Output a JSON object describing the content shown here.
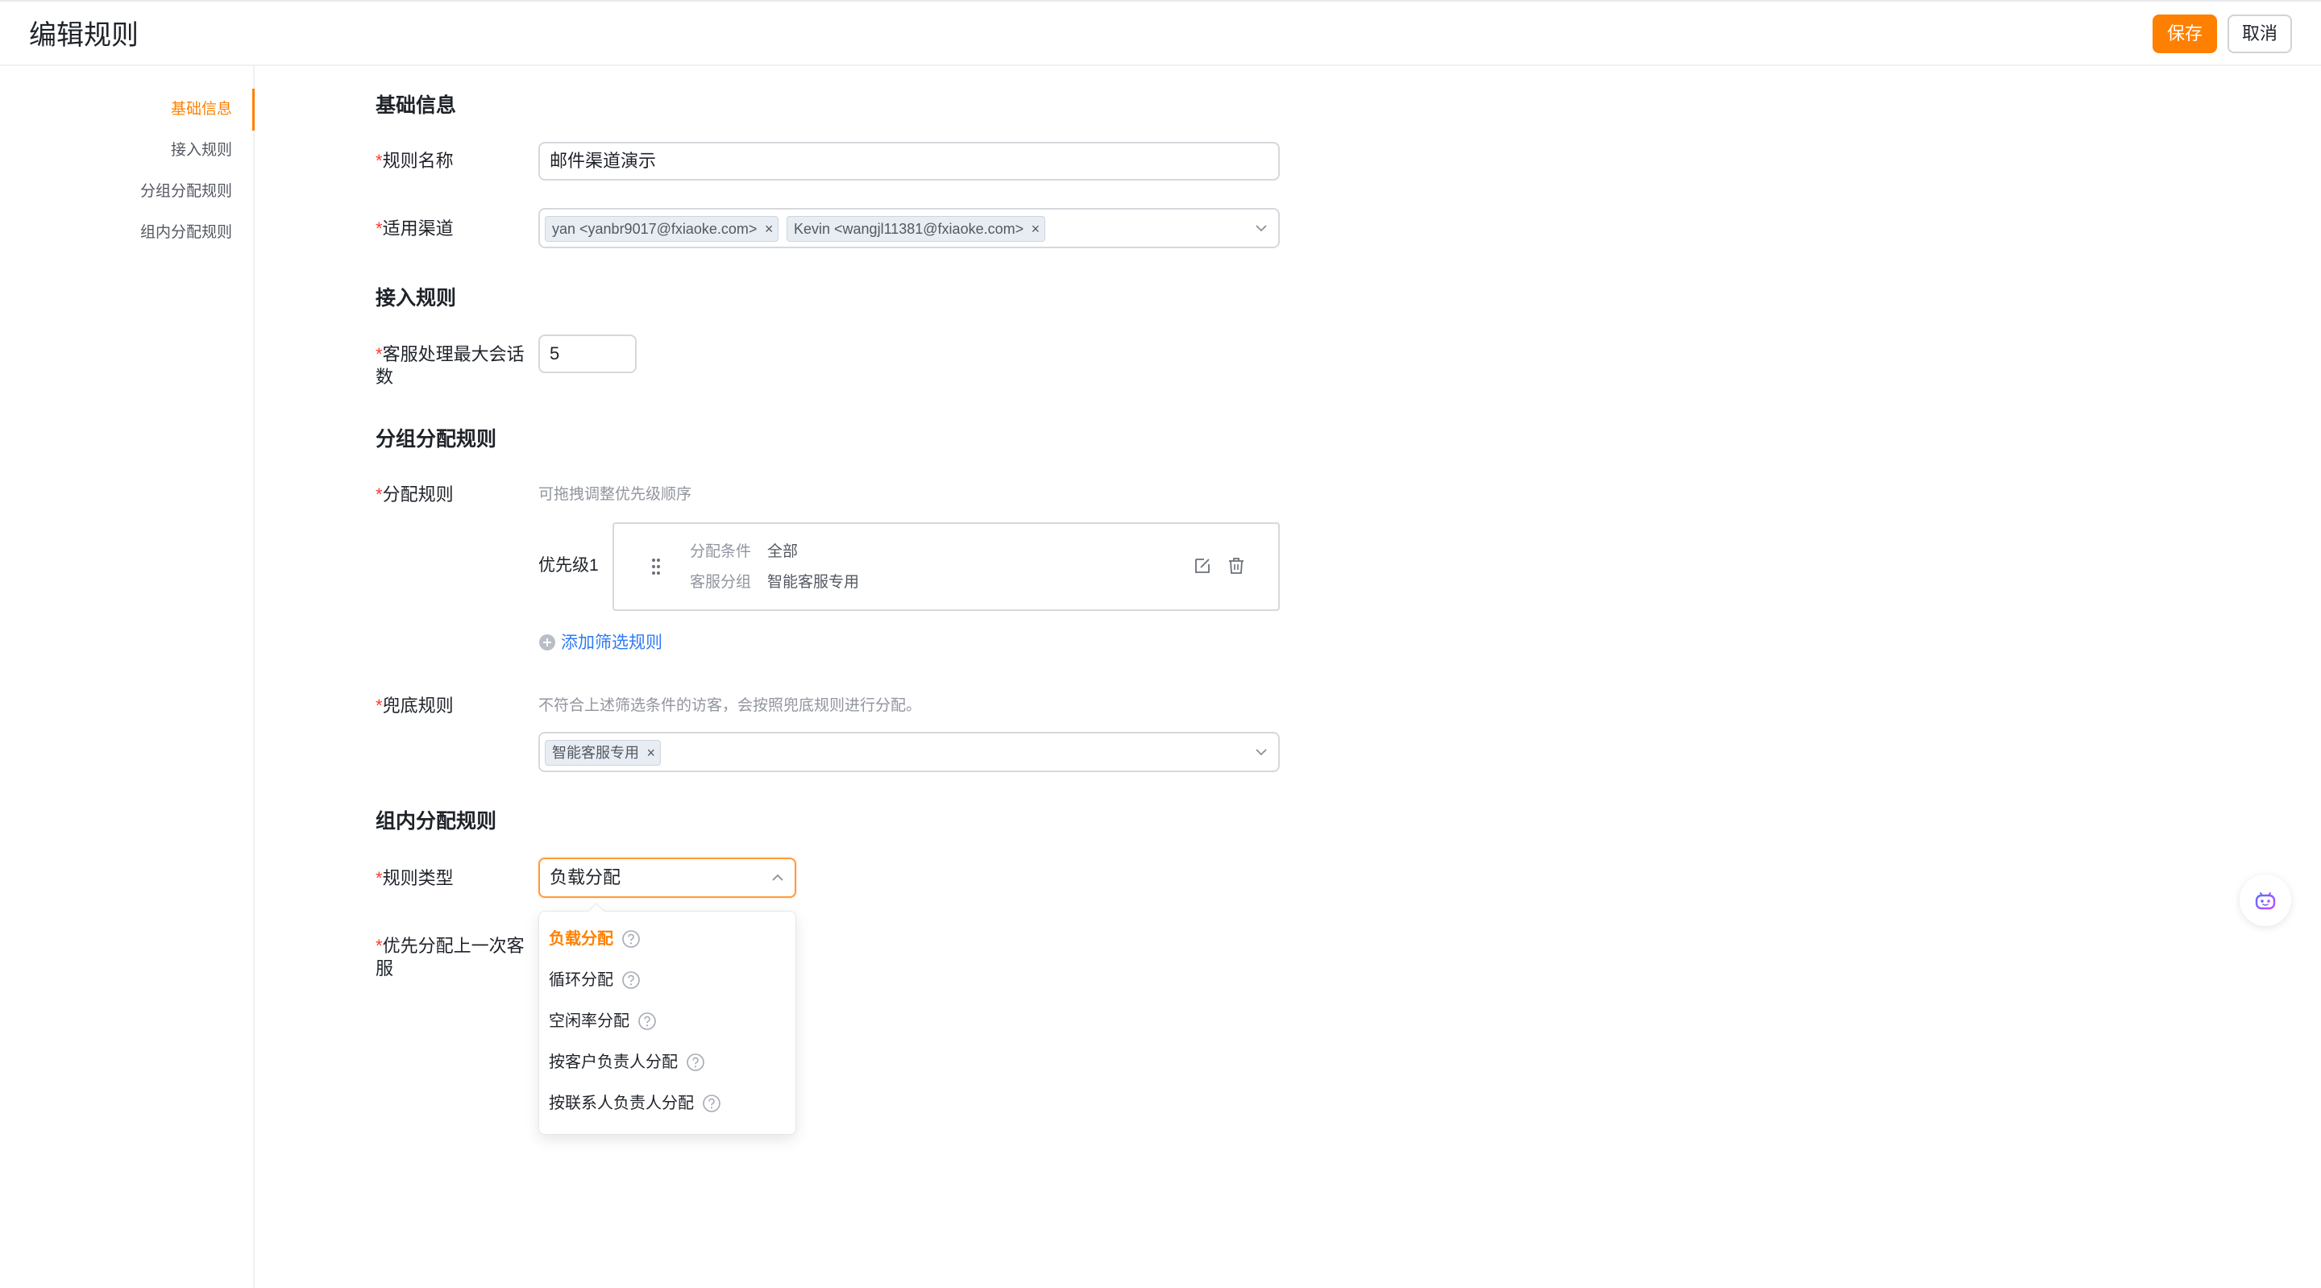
{
  "header": {
    "title": "编辑规则",
    "save_label": "保存",
    "cancel_label": "取消"
  },
  "sidenav": {
    "items": [
      {
        "label": "基础信息",
        "active": true
      },
      {
        "label": "接入规则",
        "active": false
      },
      {
        "label": "分组分配规则",
        "active": false
      },
      {
        "label": "组内分配规则",
        "active": false
      }
    ]
  },
  "basic": {
    "section_title": "基础信息",
    "name_label": "规则名称",
    "name_value": "邮件渠道演示",
    "channel_label": "适用渠道",
    "channel_tags": [
      "yan <yanbr9017@fxiaoke.com>",
      "Kevin <wangjl11381@fxiaoke.com>"
    ]
  },
  "access": {
    "section_title": "接入规则",
    "max_sessions_label_line1": "客服处理最大会话",
    "max_sessions_label_line2": "数",
    "max_sessions_value": "5"
  },
  "group": {
    "section_title": "分组分配规则",
    "rule_label": "分配规则",
    "rule_hint": "可拖拽调整优先级顺序",
    "priority_label": "优先级1",
    "condition_key": "分配条件",
    "condition_value": "全部",
    "group_key": "客服分组",
    "group_value": "智能客服专用",
    "add_rule_label": "添加筛选规则",
    "fallback_label": "兜底规则",
    "fallback_hint": "不符合上述筛选条件的访客，会按照兜底规则进行分配。",
    "fallback_tags": [
      "智能客服专用"
    ]
  },
  "inner": {
    "section_title": "组内分配规则",
    "type_label": "规则类型",
    "type_value": "负载分配",
    "prefer_label_line1": "优先分配上一次客",
    "prefer_label_line2": "服",
    "options": [
      {
        "label": "负载分配",
        "selected": true
      },
      {
        "label": "循环分配",
        "selected": false
      },
      {
        "label": "空闲率分配",
        "selected": false
      },
      {
        "label": "按客户负责人分配",
        "selected": false
      },
      {
        "label": "按联系人负责人分配",
        "selected": false
      }
    ]
  },
  "colors": {
    "accent": "#ff8000",
    "link": "#2f7bf5",
    "required": "#ff3b30"
  },
  "icons": {
    "drag": "drag-handle-icon",
    "edit": "edit-icon",
    "delete": "trash-icon",
    "add": "plus-circle-icon",
    "help": "question-icon",
    "bot": "robot-icon"
  }
}
